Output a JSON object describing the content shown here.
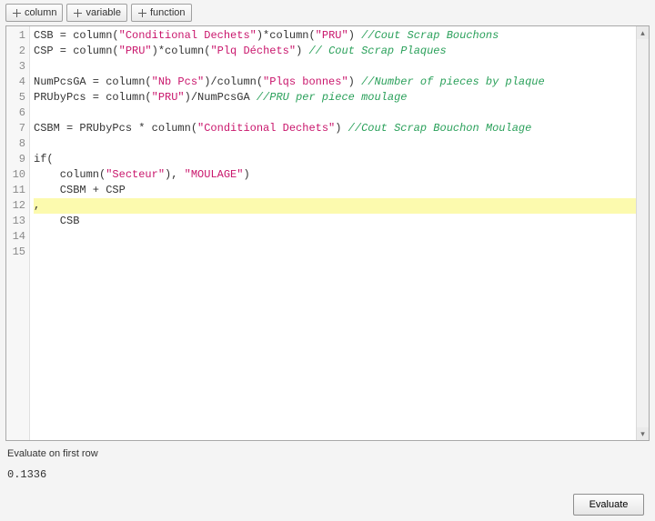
{
  "toolbar": {
    "column_label": "column",
    "variable_label": "variable",
    "function_label": "function"
  },
  "code": {
    "lines": [
      {
        "n": 1,
        "hl": false,
        "segments": [
          {
            "t": "CSB = column(",
            "c": ""
          },
          {
            "t": "\"Conditional Dechets\"",
            "c": "tok-str"
          },
          {
            "t": ")*column(",
            "c": ""
          },
          {
            "t": "\"PRU\"",
            "c": "tok-str"
          },
          {
            "t": ") ",
            "c": ""
          },
          {
            "t": "//Cout Scrap Bouchons",
            "c": "tok-comment"
          }
        ]
      },
      {
        "n": 2,
        "hl": false,
        "segments": [
          {
            "t": "CSP = column(",
            "c": ""
          },
          {
            "t": "\"PRU\"",
            "c": "tok-str"
          },
          {
            "t": ")*column(",
            "c": ""
          },
          {
            "t": "\"Plq Déchets\"",
            "c": "tok-str"
          },
          {
            "t": ") ",
            "c": ""
          },
          {
            "t": "// Cout Scrap Plaques",
            "c": "tok-comment"
          }
        ]
      },
      {
        "n": 3,
        "hl": false,
        "segments": []
      },
      {
        "n": 4,
        "hl": false,
        "segments": [
          {
            "t": "NumPcsGA = column(",
            "c": ""
          },
          {
            "t": "\"Nb Pcs\"",
            "c": "tok-str"
          },
          {
            "t": ")/column(",
            "c": ""
          },
          {
            "t": "\"Plqs bonnes\"",
            "c": "tok-str"
          },
          {
            "t": ") ",
            "c": ""
          },
          {
            "t": "//Number of pieces by plaque",
            "c": "tok-comment"
          }
        ]
      },
      {
        "n": 5,
        "hl": false,
        "segments": [
          {
            "t": "PRUbyPcs = column(",
            "c": ""
          },
          {
            "t": "\"PRU\"",
            "c": "tok-str"
          },
          {
            "t": ")/NumPcsGA ",
            "c": ""
          },
          {
            "t": "//PRU per piece moulage",
            "c": "tok-comment"
          }
        ]
      },
      {
        "n": 6,
        "hl": false,
        "segments": []
      },
      {
        "n": 7,
        "hl": false,
        "segments": [
          {
            "t": "CSBM = PRUbyPcs * column(",
            "c": ""
          },
          {
            "t": "\"Conditional Dechets\"",
            "c": "tok-str"
          },
          {
            "t": ") ",
            "c": ""
          },
          {
            "t": "//Cout Scrap Bouchon Moulage",
            "c": "tok-comment"
          }
        ]
      },
      {
        "n": 8,
        "hl": false,
        "segments": []
      },
      {
        "n": 9,
        "hl": false,
        "segments": [
          {
            "t": "if(",
            "c": "tok-kw"
          }
        ]
      },
      {
        "n": 10,
        "hl": false,
        "segments": [
          {
            "t": "    column(",
            "c": ""
          },
          {
            "t": "\"Secteur\"",
            "c": "tok-str"
          },
          {
            "t": "), ",
            "c": ""
          },
          {
            "t": "\"MOULAGE\"",
            "c": "tok-str"
          },
          {
            "t": ")",
            "c": ""
          }
        ]
      },
      {
        "n": 11,
        "hl": false,
        "segments": [
          {
            "t": "    CSBM + CSP",
            "c": ""
          }
        ]
      },
      {
        "n": 12,
        "hl": true,
        "segments": [
          {
            "t": ",",
            "c": ""
          }
        ]
      },
      {
        "n": 13,
        "hl": false,
        "segments": [
          {
            "t": "    CSB",
            "c": ""
          }
        ]
      },
      {
        "n": 14,
        "hl": false,
        "segments": []
      },
      {
        "n": 15,
        "hl": false,
        "segments": []
      }
    ]
  },
  "eval": {
    "label": "Evaluate on first row",
    "value": "0.1336",
    "button": "Evaluate"
  },
  "icons": {
    "plus": "plus-icon"
  }
}
